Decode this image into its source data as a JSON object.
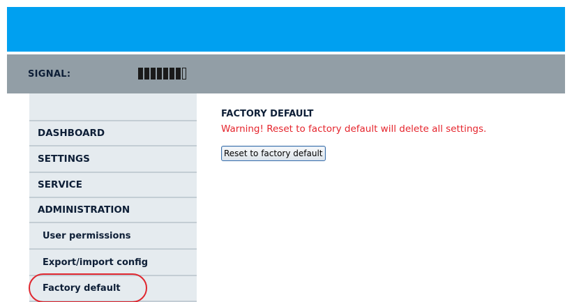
{
  "header": {
    "signal_label": "SIGNAL:",
    "signal_strength": {
      "filled": 7,
      "total": 8
    },
    "banner_color": "#00a0f0",
    "status_bar_color": "#929ea6"
  },
  "sidebar": {
    "items": [
      {
        "label": "",
        "level": "top"
      },
      {
        "label": "DASHBOARD",
        "level": "top"
      },
      {
        "label": "SETTINGS",
        "level": "top"
      },
      {
        "label": "SERVICE",
        "level": "top"
      },
      {
        "label": "ADMINISTRATION",
        "level": "top"
      },
      {
        "label": "User permissions",
        "level": "sub"
      },
      {
        "label": "Export/import config",
        "level": "sub"
      },
      {
        "label": "Factory default",
        "level": "sub",
        "highlighted": true
      }
    ],
    "highlight_color": "#e0262e"
  },
  "main": {
    "title": "FACTORY DEFAULT",
    "warning": "Warning! Reset to factory default will delete all settings.",
    "warning_color": "#e5242c",
    "reset_button_label": "Reset to factory default"
  }
}
